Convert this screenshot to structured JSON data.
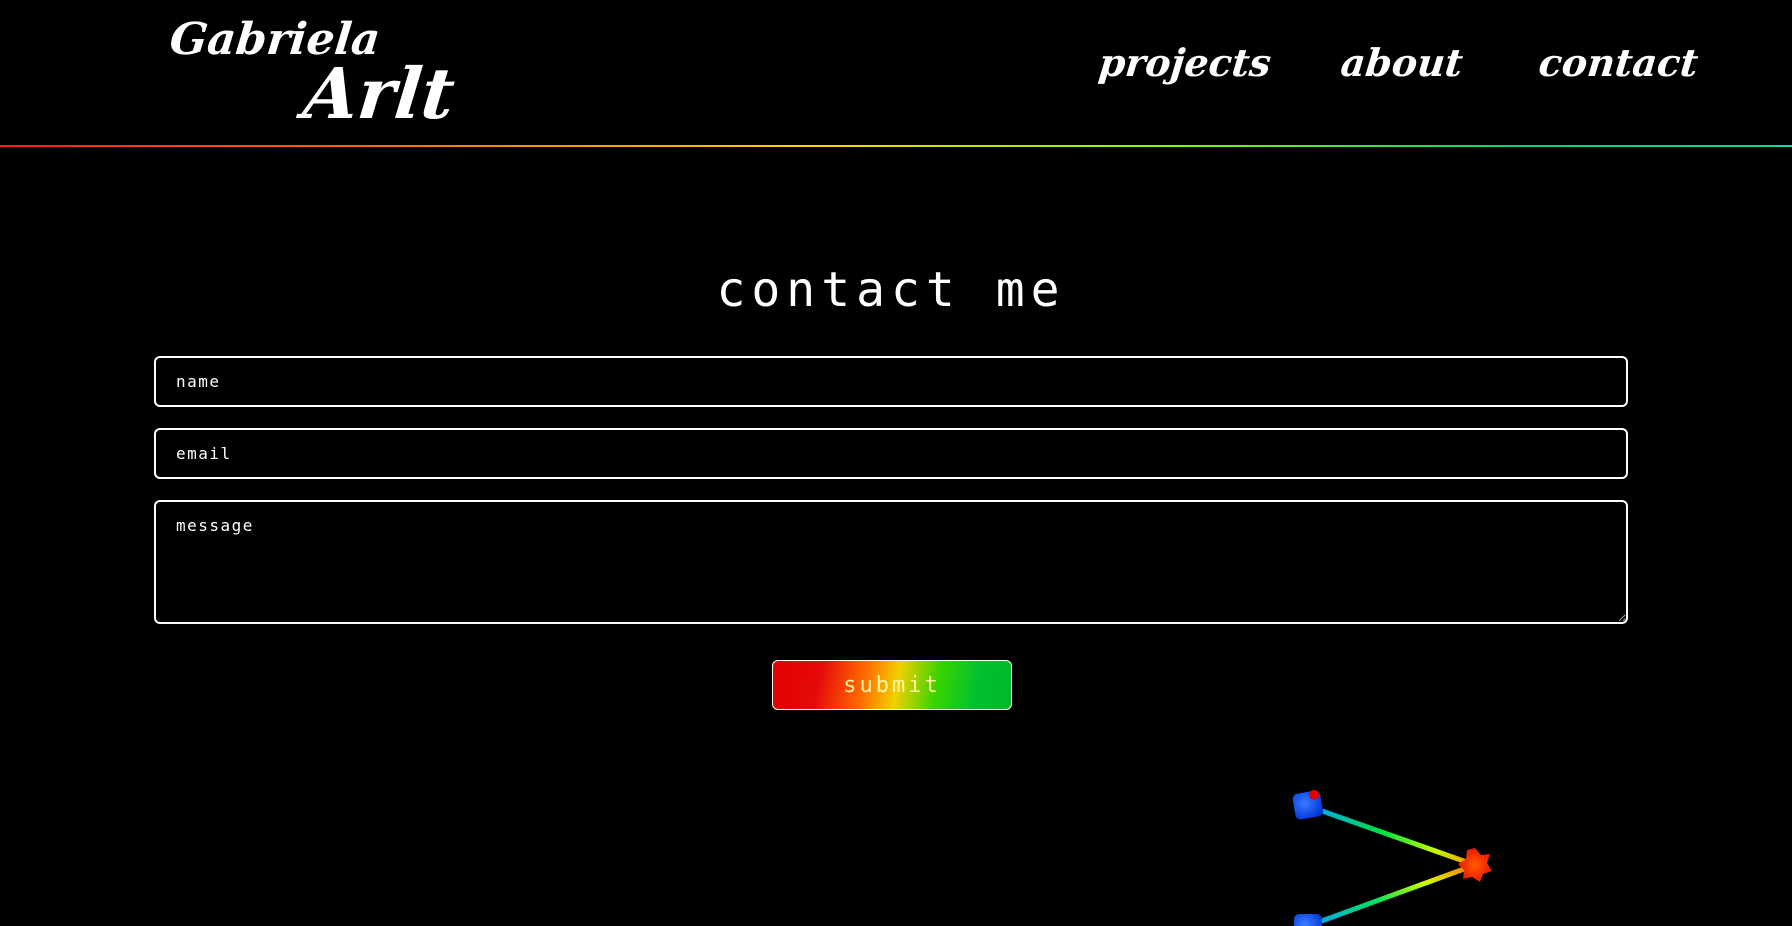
{
  "logo": {
    "line1": "Gabriela",
    "line2": "Arlt"
  },
  "nav": {
    "projects": "projects",
    "about": "about",
    "contact": "contact"
  },
  "contact": {
    "title": "contact me",
    "name_placeholder": "name",
    "email_placeholder": "email",
    "message_placeholder": "message",
    "submit_label": "submit"
  },
  "colors": {
    "background": "#000000",
    "text": "#ffffff",
    "rainbow": [
      "#ff1a1a",
      "#ff7a00",
      "#ffd400",
      "#7cff00",
      "#00d27a"
    ]
  },
  "icons": {
    "decoration": "rainbow-triangle-icon"
  }
}
